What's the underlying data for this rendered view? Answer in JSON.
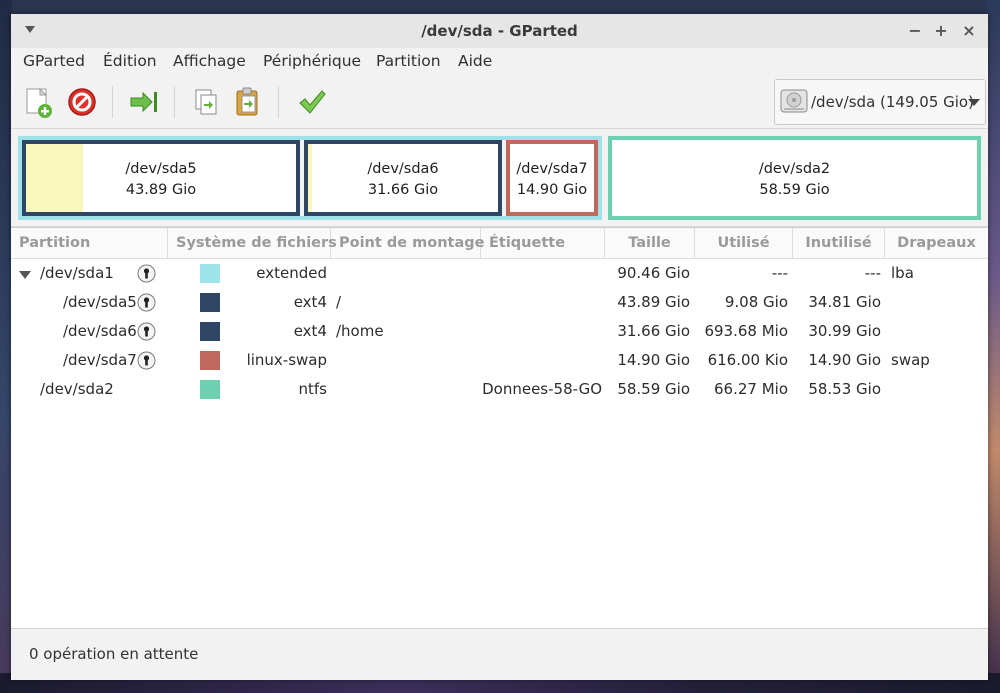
{
  "window": {
    "title": "/dev/sda - GParted"
  },
  "menu": [
    "GParted",
    "Édition",
    "Affichage",
    "Périphérique",
    "Partition",
    "Aide"
  ],
  "toolbar": {
    "icons": [
      "new-partition-icon",
      "delete-icon",
      "resize-move-icon",
      "copy-icon",
      "paste-icon",
      "apply-icon"
    ],
    "device_label": "/dev/sda (149.05 Gio)"
  },
  "partition_map": [
    {
      "name": "/dev/sda5",
      "size": "43.89 Gio",
      "border": "#2e4563",
      "used_fraction": 0.21
    },
    {
      "name": "/dev/sda6",
      "size": "31.66 Gio",
      "border": "#2e4563",
      "used_fraction": 0.02
    },
    {
      "name": "/dev/sda7",
      "size": "14.90 Gio",
      "border": "#c0675e",
      "used_fraction": 0.0
    },
    {
      "name": "/dev/sda2",
      "size": "58.59 Gio",
      "border": "#6dd0b0",
      "used_fraction": 0.0
    }
  ],
  "extended_border": "#9ee2ea",
  "table": {
    "headers": [
      "Partition",
      "Système de fichiers",
      "Point de montage",
      "Étiquette",
      "Taille",
      "Utilisé",
      "Inutilisé",
      "Drapeaux"
    ],
    "rows": [
      {
        "partition": "/dev/sda1",
        "fs": "extended",
        "color": "#9ee2ea",
        "mount": "",
        "label": "",
        "size": "90.46 Gio",
        "used": "---",
        "unused": "---",
        "flags": "lba",
        "indent": 0,
        "expandable": true,
        "locked": true
      },
      {
        "partition": "/dev/sda5",
        "fs": "ext4",
        "color": "#2e4563",
        "mount": "/",
        "label": "",
        "size": "43.89 Gio",
        "used": "9.08 Gio",
        "unused": "34.81 Gio",
        "flags": "",
        "indent": 1,
        "expandable": false,
        "locked": true
      },
      {
        "partition": "/dev/sda6",
        "fs": "ext4",
        "color": "#2e4563",
        "mount": "/home",
        "label": "",
        "size": "31.66 Gio",
        "used": "693.68 Mio",
        "unused": "30.99 Gio",
        "flags": "",
        "indent": 1,
        "expandable": false,
        "locked": true
      },
      {
        "partition": "/dev/sda7",
        "fs": "linux-swap",
        "color": "#c0675e",
        "mount": "",
        "label": "",
        "size": "14.90 Gio",
        "used": "616.00 Kio",
        "unused": "14.90 Gio",
        "flags": "swap",
        "indent": 1,
        "expandable": false,
        "locked": true
      },
      {
        "partition": "/dev/sda2",
        "fs": "ntfs",
        "color": "#6dd0b0",
        "mount": "",
        "label": "Donnees-58-GO",
        "size": "58.59 Gio",
        "used": "66.27 Mio",
        "unused": "58.53 Gio",
        "flags": "",
        "indent": 0,
        "expandable": false,
        "locked": false
      }
    ]
  },
  "status": {
    "text": "0 opération en attente"
  }
}
